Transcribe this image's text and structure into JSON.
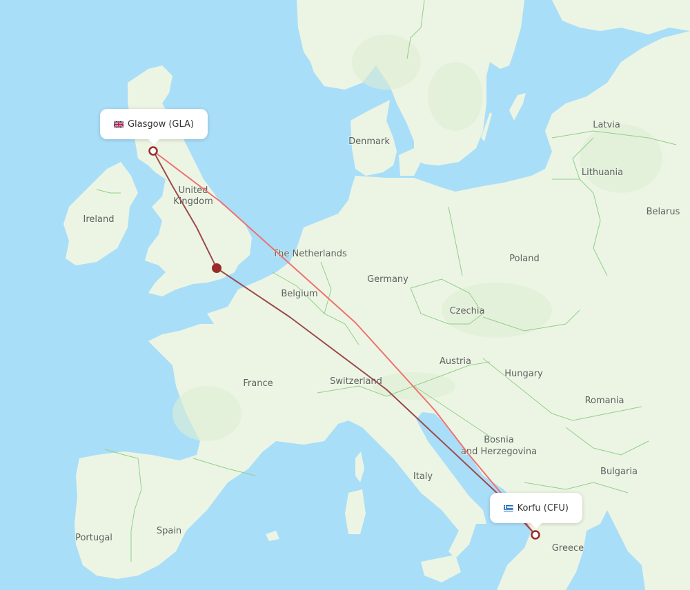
{
  "map": {
    "colors": {
      "sea": "#a9def9",
      "land": "#ecf5e3",
      "land_shade": "#dfeed4",
      "border": "#8fcf8a",
      "route_direct": "#f07070",
      "route_via": "#9c4a4a",
      "marker": "#9a2a2a"
    },
    "country_labels": [
      {
        "name": "Latvia"
      },
      {
        "name": "Lithuania"
      },
      {
        "name": "Belarus"
      },
      {
        "name": "Denmark"
      },
      {
        "name": "United"
      },
      {
        "name": "Kingdom"
      },
      {
        "name": "Ireland"
      },
      {
        "name": "The Netherlands"
      },
      {
        "name": "Germany"
      },
      {
        "name": "Poland"
      },
      {
        "name": "Belgium"
      },
      {
        "name": "Czechia"
      },
      {
        "name": "Austria"
      },
      {
        "name": "Hungary"
      },
      {
        "name": "Romania"
      },
      {
        "name": "France"
      },
      {
        "name": "Switzerland"
      },
      {
        "name": "Bosnia"
      },
      {
        "name": "and Herzegovina"
      },
      {
        "name": "Italy"
      },
      {
        "name": "Bulgaria"
      },
      {
        "name": "Portugal"
      },
      {
        "name": "Spain"
      },
      {
        "name": "Greece"
      }
    ],
    "origin": {
      "label": "Glasgow (GLA)",
      "flag_icon": "uk-flag-icon"
    },
    "destination": {
      "label": "Korfu (CFU)",
      "flag_icon": "greece-flag-icon"
    },
    "stopover": {
      "name": "London area stopover"
    },
    "routes": [
      {
        "name": "direct-route",
        "from": "GLA",
        "to": "CFU"
      },
      {
        "name": "via-london-route",
        "from": "GLA",
        "via": "London",
        "to": "CFU"
      }
    ]
  }
}
